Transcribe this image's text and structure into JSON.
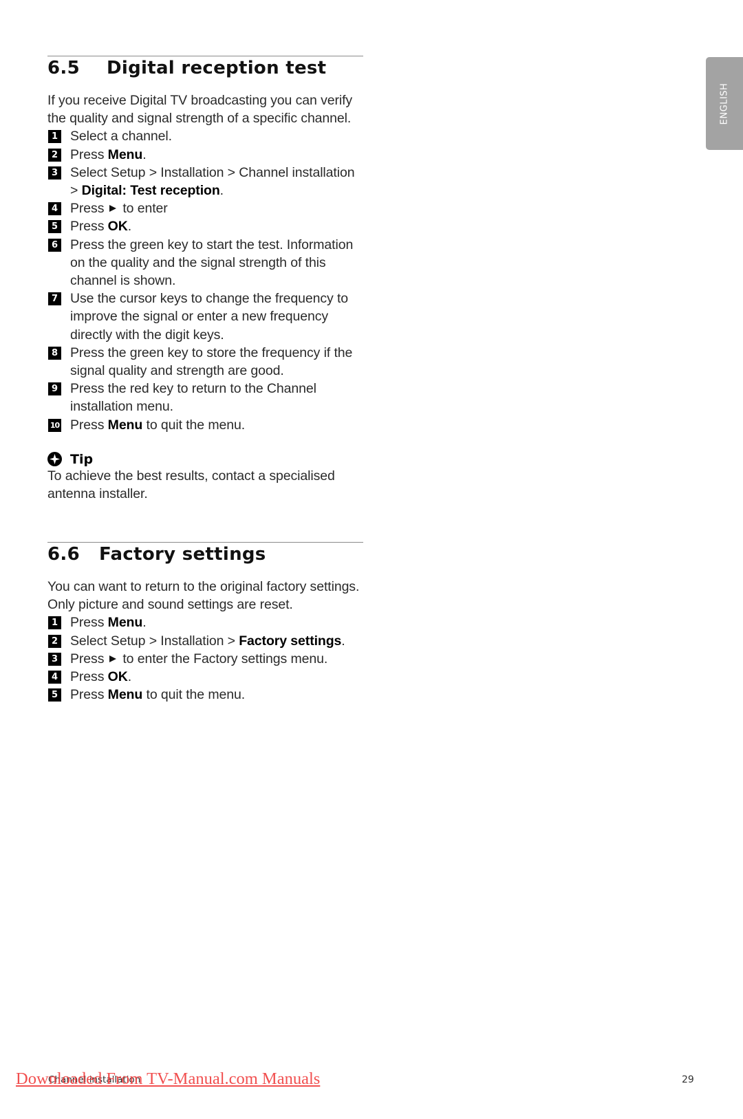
{
  "side_tab": {
    "label": "ENGLISH"
  },
  "section_65": {
    "number": "6.5",
    "title": "Digital reception test",
    "intro": "If you receive Digital TV broadcasting you can verify the quality and signal strength of a specific channel.",
    "steps": [
      {
        "n": "1",
        "parts": [
          {
            "t": "Select a channel."
          }
        ]
      },
      {
        "n": "2",
        "parts": [
          {
            "t": "Press "
          },
          {
            "t": "Menu",
            "b": true
          },
          {
            "t": "."
          }
        ]
      },
      {
        "n": "3",
        "parts": [
          {
            "t": "Select Setup > Installation > Channel installation > "
          },
          {
            "t": "Digital: Test reception",
            "b": true
          },
          {
            "t": "."
          }
        ]
      },
      {
        "n": "4",
        "parts": [
          {
            "t": "Press"
          },
          {
            "icon": "right-triangle"
          },
          {
            "t": "to enter"
          }
        ]
      },
      {
        "n": "5",
        "parts": [
          {
            "t": "Press "
          },
          {
            "t": "OK",
            "b": true
          },
          {
            "t": "."
          }
        ]
      },
      {
        "n": "6",
        "parts": [
          {
            "t": "Press the green key to start the test. Information on the quality and the signal strength of this channel is shown."
          }
        ]
      },
      {
        "n": "7",
        "parts": [
          {
            "t": "Use the cursor keys to change the frequency to improve the signal or enter a new frequency directly with the digit keys."
          }
        ]
      },
      {
        "n": "8",
        "parts": [
          {
            "t": "Press the green key to store the frequency if the signal quality and strength are good."
          }
        ]
      },
      {
        "n": "9",
        "parts": [
          {
            "t": "Press the red key to return to the Channel installation menu."
          }
        ]
      },
      {
        "n": "10",
        "parts": [
          {
            "t": "Press "
          },
          {
            "t": "Menu",
            "b": true
          },
          {
            "t": " to quit the menu."
          }
        ]
      }
    ],
    "tip": {
      "title": "Tip",
      "text": "To achieve the best results, contact a specialised antenna installer."
    }
  },
  "section_66": {
    "number": "6.6",
    "title": "Factory settings",
    "intro": "You can want to return to the original factory settings. Only picture and sound settings are reset.",
    "steps": [
      {
        "n": "1",
        "parts": [
          {
            "t": "Press "
          },
          {
            "t": "Menu",
            "b": true
          },
          {
            "t": "."
          }
        ]
      },
      {
        "n": "2",
        "parts": [
          {
            "t": "Select Setup > Installation > "
          },
          {
            "t": "Factory settings",
            "b": true
          },
          {
            "t": "."
          }
        ]
      },
      {
        "n": "3",
        "parts": [
          {
            "t": "Press"
          },
          {
            "icon": "right-triangle"
          },
          {
            "t": "to enter the Factory settings menu."
          }
        ]
      },
      {
        "n": "4",
        "parts": [
          {
            "t": "Press "
          },
          {
            "t": "OK",
            "b": true
          },
          {
            "t": "."
          }
        ]
      },
      {
        "n": "5",
        "parts": [
          {
            "t": "Press "
          },
          {
            "t": "Menu",
            "b": true
          },
          {
            "t": " to quit the menu."
          }
        ]
      }
    ]
  },
  "footer": {
    "chapter": "Channel installation",
    "page_number": "29",
    "watermark": "Downloaded From TV-Manual.com Manuals"
  }
}
